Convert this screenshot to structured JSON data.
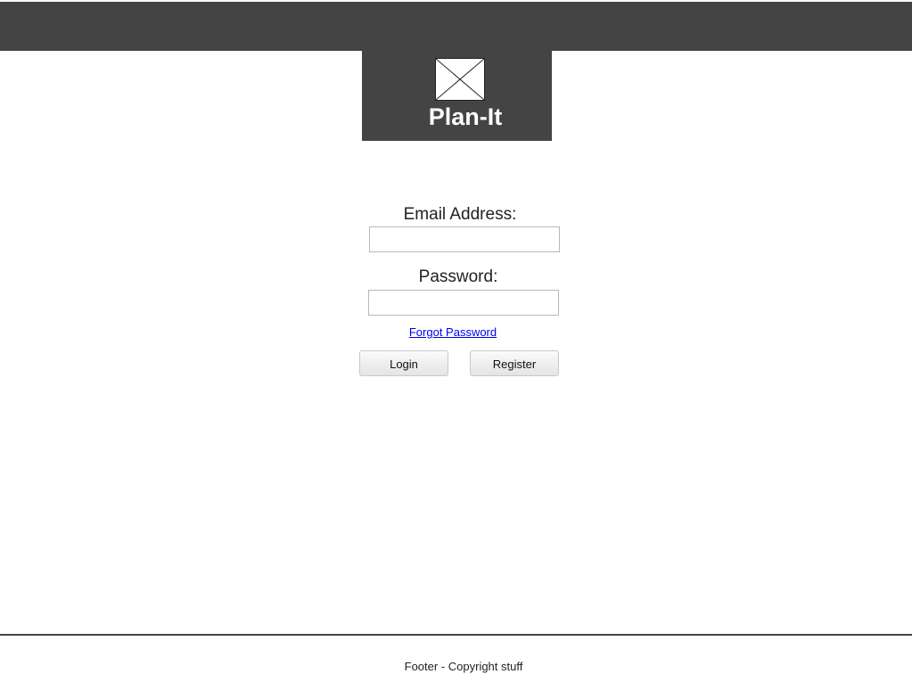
{
  "header": {
    "app_title": "Plan-It",
    "logo_icon": "image-placeholder-icon"
  },
  "login_form": {
    "email_label": "Email Address:",
    "email_value": "",
    "password_label": "Password:",
    "password_value": "",
    "forgot_password": "Forgot Password",
    "login_button": "Login",
    "register_button": "Register"
  },
  "footer": {
    "text": "Footer - Copyright stuff"
  },
  "colors": {
    "header_background": "#444444",
    "link": "#0000ee",
    "page_background": "#ffffff"
  }
}
